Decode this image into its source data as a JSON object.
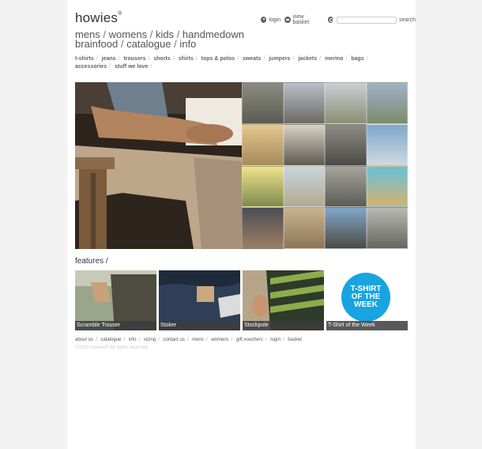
{
  "brand": "howies",
  "brand_mark": "®",
  "utility": {
    "login": "login",
    "view_basket": "view basket",
    "search_button": "search"
  },
  "main_nav_row1": [
    "mens",
    "womens",
    "kids",
    "handmedown"
  ],
  "main_nav_row2": [
    "brainfood",
    "catalogue",
    "info"
  ],
  "category_nav": [
    "t-shirts",
    "jeans",
    "trousers",
    "shorts",
    "shirts",
    "tops & polos",
    "sweats",
    "jumpers",
    "jackets",
    "merino",
    "bags",
    "accessories",
    "stuff we love"
  ],
  "features": {
    "title": "features /",
    "items": [
      {
        "caption": "Scramble Trouser"
      },
      {
        "caption": "Stoker"
      },
      {
        "caption": "Stockpole"
      },
      {
        "caption": "T-Shirt of the Week",
        "badge_lines": [
          "T-SHIRT",
          "OF THE",
          "WEEK"
        ]
      }
    ]
  },
  "footer_links": [
    "about us",
    "catalogue",
    "info",
    "sizing",
    "contact us",
    "mens",
    "womens",
    "gift vouchers",
    "login",
    "basket"
  ],
  "copyright": "©2009 howies® All rights reserved",
  "colors": {
    "accent_badge": "#17a4e0",
    "page_bg": "#f2f2f2"
  }
}
